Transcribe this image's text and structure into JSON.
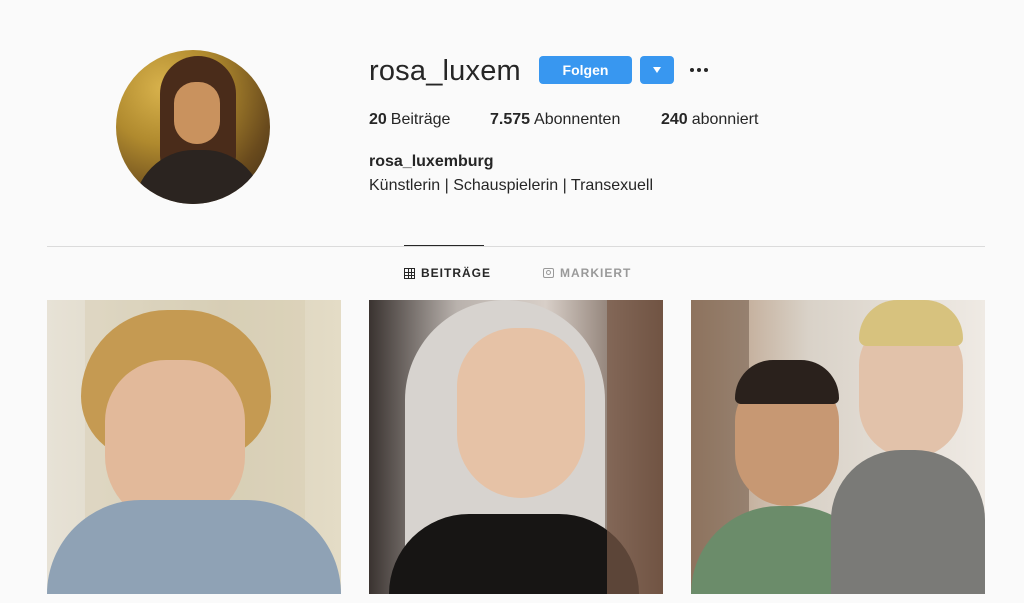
{
  "profile": {
    "username": "rosa_luxem",
    "follow_label": "Folgen",
    "full_name": "rosa_luxemburg",
    "bio": "Künstlerin | Schauspielerin | Transexuell"
  },
  "stats": {
    "posts_count": "20",
    "posts_label": "Beiträge",
    "followers_count": "7.575",
    "followers_label": "Abonnenten",
    "following_count": "240",
    "following_label": "abonniert"
  },
  "tabs": {
    "posts": "BEITRÄGE",
    "tagged": "MARKIERT"
  },
  "icons": {
    "dropdown": "chevron-down-icon",
    "more": "more-options-icon",
    "grid": "grid-icon",
    "tagged": "tagged-icon"
  },
  "colors": {
    "accent": "#3897f0",
    "background": "#fafafa",
    "text": "#262626",
    "muted": "#999999"
  }
}
